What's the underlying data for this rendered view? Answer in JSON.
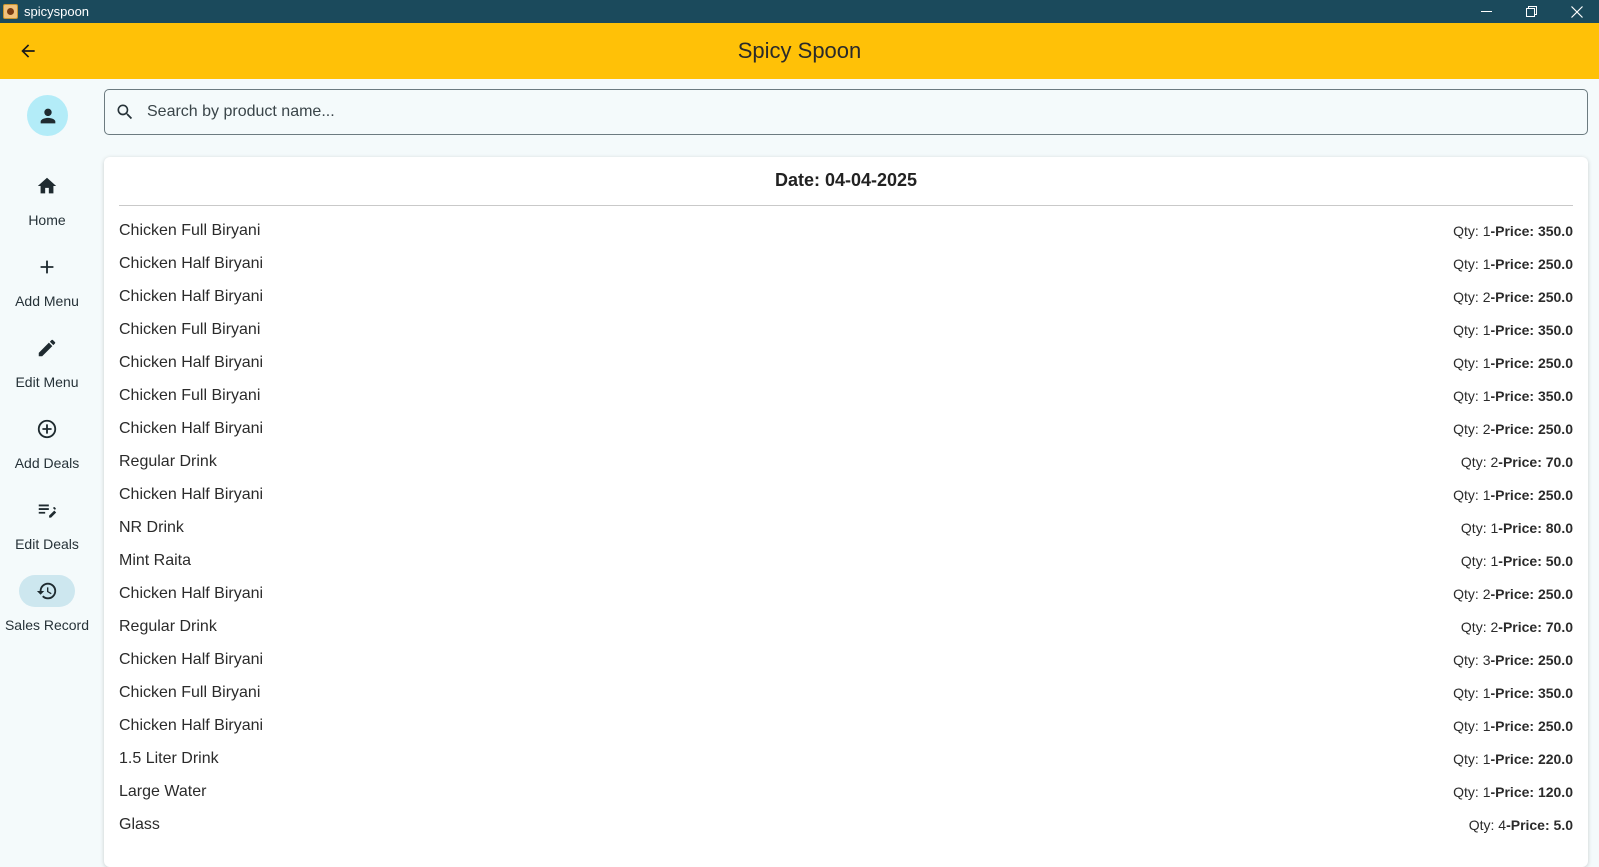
{
  "window": {
    "title": "spicyspoon",
    "icon": "app-icon",
    "controls": [
      "minimize-icon",
      "restore-icon",
      "close-icon"
    ]
  },
  "appbar": {
    "title": "Spicy Spoon",
    "back_icon": "arrow-back-icon",
    "color": "#ffc107"
  },
  "nav": {
    "avatar_icon": "person-icon",
    "items": [
      {
        "label": "Home",
        "icon": "home-icon",
        "active": false
      },
      {
        "label": "Add Menu",
        "icon": "plus-icon",
        "active": false
      },
      {
        "label": "Edit Menu",
        "icon": "pencil-icon",
        "active": false
      },
      {
        "label": "Add Deals",
        "icon": "add-circle-icon",
        "active": false
      },
      {
        "label": "Edit Deals",
        "icon": "edit-note-icon",
        "active": false
      },
      {
        "label": "Sales Record",
        "icon": "history-icon",
        "active": true
      }
    ]
  },
  "search": {
    "placeholder": "Search by product name...",
    "value": ""
  },
  "sales": {
    "date_label": "Date: 04-04-2025",
    "qty_prefix": "Qty: ",
    "price_prefix": "-Price: ",
    "items": [
      {
        "name": "Chicken Full Biryani",
        "qty": "1",
        "price": "350.0"
      },
      {
        "name": "Chicken Half Biryani",
        "qty": "1",
        "price": "250.0"
      },
      {
        "name": "Chicken Half Biryani",
        "qty": "2",
        "price": "250.0"
      },
      {
        "name": "Chicken Full Biryani",
        "qty": "1",
        "price": "350.0"
      },
      {
        "name": "Chicken Half Biryani",
        "qty": "1",
        "price": "250.0"
      },
      {
        "name": "Chicken Full Biryani",
        "qty": "1",
        "price": "350.0"
      },
      {
        "name": "Chicken Half Biryani",
        "qty": "2",
        "price": "250.0"
      },
      {
        "name": "Regular Drink",
        "qty": "2",
        "price": "70.0"
      },
      {
        "name": "Chicken Half Biryani",
        "qty": "1",
        "price": "250.0"
      },
      {
        "name": "NR Drink",
        "qty": "1",
        "price": "80.0"
      },
      {
        "name": "Mint Raita",
        "qty": "1",
        "price": "50.0"
      },
      {
        "name": "Chicken Half Biryani",
        "qty": "2",
        "price": "250.0"
      },
      {
        "name": "Regular Drink",
        "qty": "2",
        "price": "70.0"
      },
      {
        "name": "Chicken Half Biryani",
        "qty": "3",
        "price": "250.0"
      },
      {
        "name": "Chicken Full Biryani",
        "qty": "1",
        "price": "350.0"
      },
      {
        "name": "Chicken Half Biryani",
        "qty": "1",
        "price": "250.0"
      },
      {
        "name": "1.5 Liter Drink",
        "qty": "1",
        "price": "220.0"
      },
      {
        "name": "Large Water",
        "qty": "1",
        "price": "120.0"
      },
      {
        "name": "Glass",
        "qty": "4",
        "price": "5.0"
      }
    ]
  }
}
